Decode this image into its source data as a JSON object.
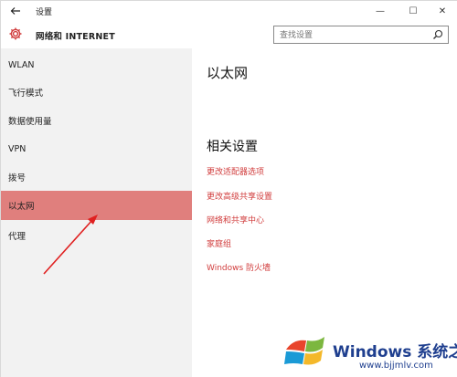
{
  "window": {
    "title": "设置",
    "controls": {
      "minimize": "—",
      "maximize": "☐",
      "close": "✕"
    }
  },
  "header": {
    "title": "网络和 INTERNET",
    "search": {
      "placeholder": "查找设置"
    }
  },
  "sidebar": {
    "items": [
      {
        "label": "WLAN",
        "active": false
      },
      {
        "label": "飞行模式",
        "active": false
      },
      {
        "label": "数据使用量",
        "active": false
      },
      {
        "label": "VPN",
        "active": false
      },
      {
        "label": "拨号",
        "active": false
      },
      {
        "label": "以太网",
        "active": true
      },
      {
        "label": "代理",
        "active": false
      }
    ],
    "active_color": "#e07f7d"
  },
  "main": {
    "title": "以太网",
    "related_settings_title": "相关设置",
    "links": [
      "更改适配器选项",
      "更改高级共享设置",
      "网络和共享中心",
      "家庭组",
      "Windows 防火墙"
    ],
    "link_color": "#d13d3d"
  },
  "watermark": {
    "brand": "Windows 系统之家",
    "url": "www.bjjmlv.com"
  }
}
